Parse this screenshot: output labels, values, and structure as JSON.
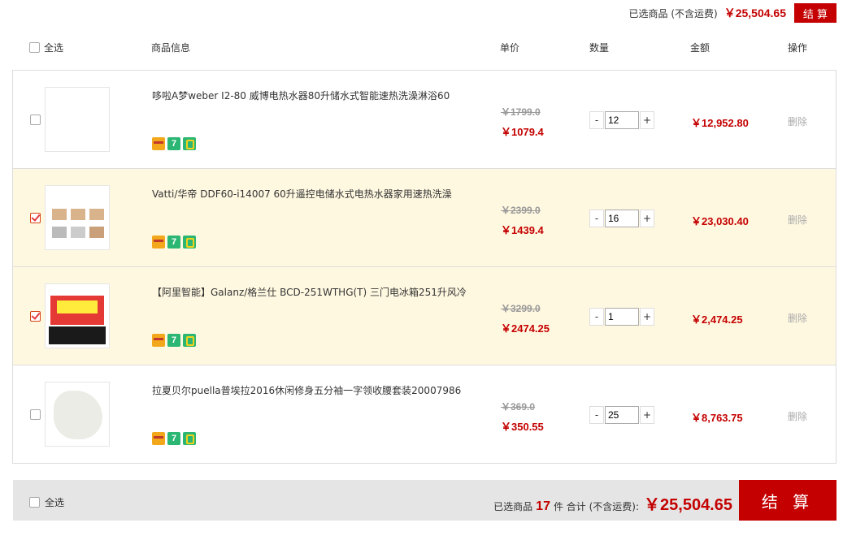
{
  "summary_top": {
    "label": "已选商品 (不含运费)",
    "total": "￥25,504.65",
    "checkout_label": "结 算"
  },
  "table_header": {
    "select_all": "全选",
    "product_info": "商品信息",
    "unit_price": "单价",
    "quantity": "数量",
    "amount": "金额",
    "action": "操作"
  },
  "items": [
    {
      "title": "哆啦A梦weber I2-80 威博电热水器80升储水式智能速热洗澡淋浴60",
      "old_price": "￥1799.0",
      "price": "￥1079.4",
      "quantity": "12",
      "amount": "￥12,952.80",
      "delete_label": "删除",
      "selected": false
    },
    {
      "title": "Vatti/华帝 DDF60-i14007 60升遥控电储水式电热水器家用速热洗澡",
      "old_price": "￥2399.0",
      "price": "￥1439.4",
      "quantity": "16",
      "amount": "￥23,030.40",
      "delete_label": "删除",
      "selected": true
    },
    {
      "title": "【阿里智能】Galanz/格兰仕 BCD-251WTHG(T) 三门电冰箱251升风冷",
      "old_price": "￥3299.0",
      "price": "￥2474.25",
      "quantity": "1",
      "amount": "￥2,474.25",
      "delete_label": "删除",
      "selected": true
    },
    {
      "title": "拉夏贝尔puella普埃拉2016休闲修身五分袖一字领收腰套装20007986",
      "old_price": "￥369.0",
      "price": "￥350.55",
      "quantity": "25",
      "amount": "￥8,763.75",
      "delete_label": "删除",
      "selected": false
    }
  ],
  "quantity_controls": {
    "minus": "-",
    "plus": "+"
  },
  "tags": {
    "seven": "7"
  },
  "footer": {
    "select_all": "全选",
    "selected_label": "已选商品",
    "count": "17",
    "unit_label": "件 合计 (不含运费):",
    "total": "￥25,504.65",
    "pay_label": "结 算"
  }
}
